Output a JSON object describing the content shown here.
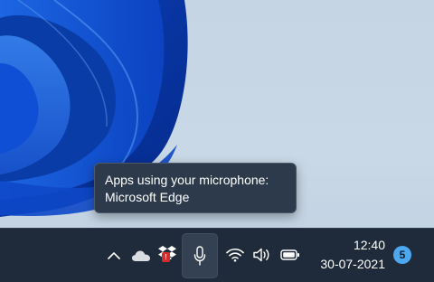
{
  "tooltip": {
    "line1": "Apps using your microphone:",
    "line2": "Microsoft Edge"
  },
  "tray": {
    "icons": [
      "chevron-up-icon",
      "onedrive-cloud-icon",
      "dropbox-icon",
      "microphone-icon",
      "wifi-icon",
      "volume-icon",
      "battery-icon"
    ],
    "dropbox_badge": "!",
    "accent_color": "#4ca8f0"
  },
  "clock": {
    "time": "12:40",
    "date": "30-07-2021"
  },
  "notifications": {
    "count": "5"
  }
}
